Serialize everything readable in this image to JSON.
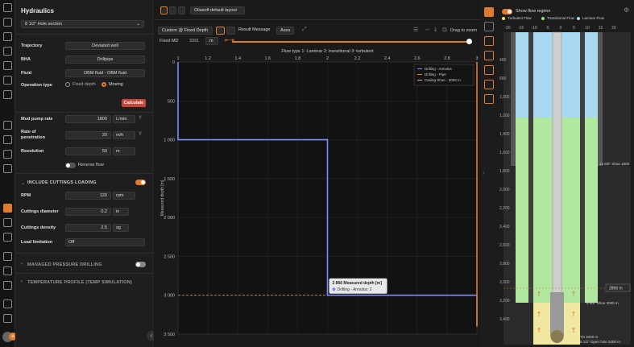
{
  "panel": {
    "title": "Hydraulics",
    "section": "8 1/2\" Hole section",
    "trajectory_label": "Trajectory",
    "trajectory_value": "Deviated well",
    "bha_label": "BHA",
    "bha_value": "Drillpipe",
    "fluid_label": "Fluid",
    "fluid_value": "OBM fluid - OBM fluid",
    "op_label": "Operation type",
    "op_fixed": "Fixed depth",
    "op_moving": "Moving",
    "calculate": "Calculate",
    "mud_label": "Mud pump rate",
    "mud_value": "1800",
    "mud_unit": "L/min",
    "rop_label1": "Rate of",
    "rop_label2": "penetration",
    "rop_value": "20",
    "rop_unit": "m/h",
    "res_label": "Resolution",
    "res_value": "50",
    "res_unit": "m",
    "reverse_flow": "Reverse flow",
    "cuttings_section": "INCLUDE CUTTINGS LOADING",
    "rpm_label": "RPM",
    "rpm_value": "120",
    "rpm_unit": "rpm",
    "cdiam_label": "Cuttings diameter",
    "cdiam_value": "0.2",
    "cdiam_unit": "in",
    "cdens_label": "Cuttings density",
    "cdens_value": "2.5",
    "cdens_unit": "sg",
    "load_label": "Load limitation",
    "load_value": "Off",
    "mpd_section": "MANAGED PRESSURE DRILLING",
    "temp_section": "TEMPERATURE PROFILE (TEMP SIMULATION)"
  },
  "toolbar": {
    "layout": "Oliasoft default layout",
    "mode": "Custom @ Fixed Depth",
    "result_message": "Result Message",
    "axes": "Axes",
    "drag_zoom": "Drag to zoom",
    "fixed_md_label": "Fixed MD",
    "fixed_md_value": "3391",
    "fixed_md_unit": "m"
  },
  "chart_data": {
    "type": "line",
    "title": "Flow type 1: Laminar 2: transitional 3: turbulent",
    "ylabel": "Measured depth [m]",
    "xlim": [
      1,
      3
    ],
    "ylim": [
      0,
      3500
    ],
    "x_ticks": [
      "1",
      "1.2",
      "1.4",
      "1.6",
      "1.8",
      "2",
      "2.2",
      "2.4",
      "2.6",
      "2.8",
      "3"
    ],
    "y_ticks": [
      "0",
      "500",
      "1 000",
      "1 500",
      "2 000",
      "2 500",
      "3 000",
      "3 500"
    ],
    "series": [
      {
        "name": "Drilling - Annulus",
        "color": "#7b8cff",
        "points": [
          [
            1,
            0
          ],
          [
            1,
            1000
          ],
          [
            2,
            1000
          ],
          [
            2,
            3000
          ],
          [
            3,
            3000
          ],
          [
            3,
            3400
          ]
        ]
      },
      {
        "name": "Drilling - Pipe",
        "color": "#e07a2f",
        "points": [
          [
            3,
            0
          ],
          [
            3,
            3400
          ]
        ]
      }
    ],
    "casing_shoe": {
      "name": "Casing Shoe - 3000 m",
      "depth": 3000,
      "color": "#e0b080"
    },
    "tooltip_title": "2 866 Measured depth [m]",
    "tooltip_item": "Drilling - Annulus: 2",
    "legend_placement": "top-right"
  },
  "schematic": {
    "show_flow_regime": "Show flow regime",
    "legend_turbulent": "Turbulent Flow",
    "legend_transitional": "Transitional Flow",
    "legend_laminar": "Laminar Flow",
    "top_ticks": [
      "-20",
      "-15",
      "-10",
      "-5",
      "0",
      "5",
      "10",
      "15",
      "20"
    ],
    "depth_ticks": [
      "400",
      "800",
      "1,000",
      "1,200",
      "1,400",
      "1,600",
      "1,800",
      "2,000",
      "2,200",
      "2,400",
      "2,600",
      "2,800",
      "3,000",
      "3,200",
      "3,400"
    ],
    "shoe1": "13 5/8\" Shoe 1500",
    "shoe2": "9 5/8\" Shoe 3000 m",
    "depth_marker": "2866 m",
    "td": "TD 3400 m",
    "open_hole": "8 1/2\" Open hole 3400 m"
  }
}
